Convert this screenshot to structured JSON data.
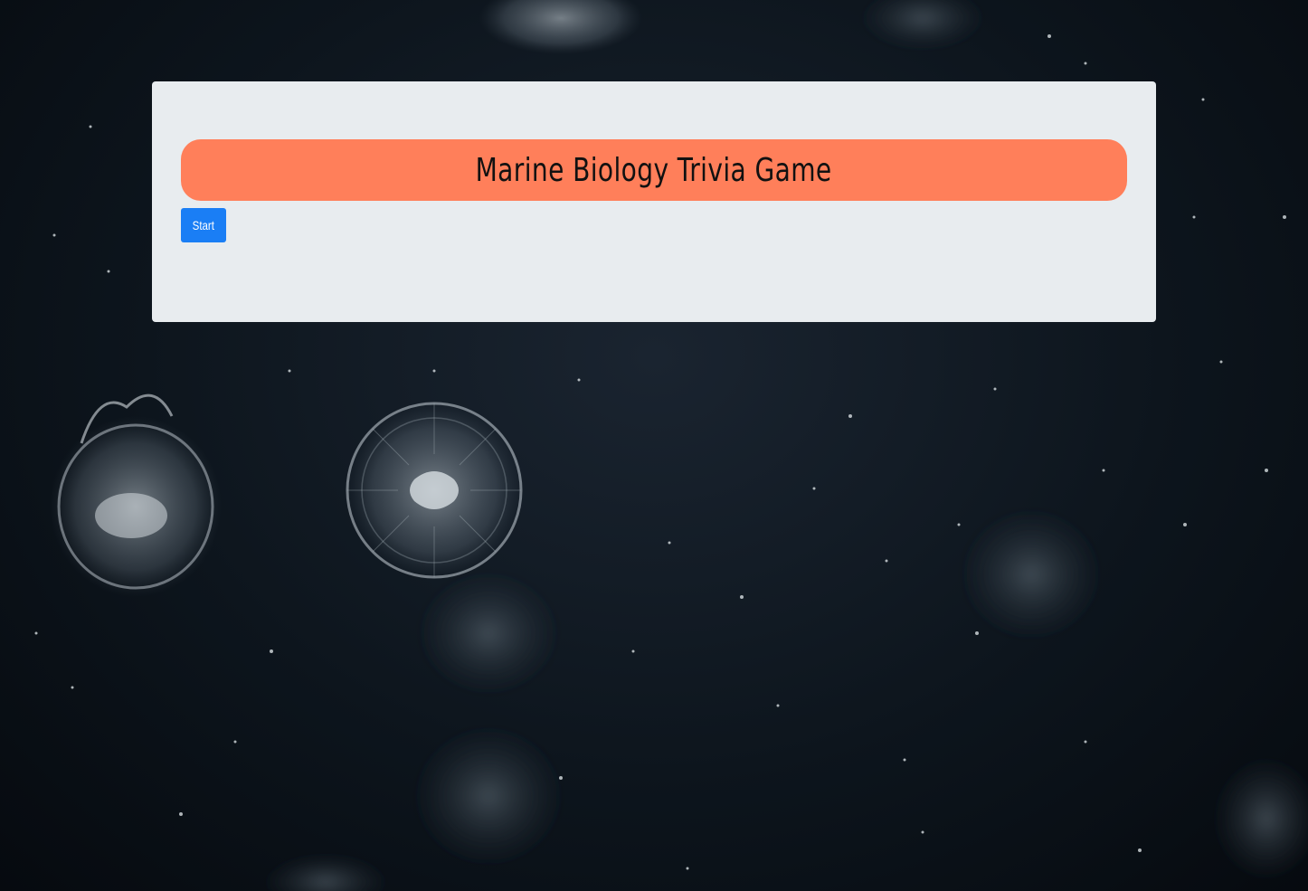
{
  "game": {
    "title": "Marine Biology Trivia Game",
    "start_label": "Start"
  },
  "colors": {
    "page_background": "#0d151d",
    "panel_background": "#e8ecef",
    "title_banner": "#ff7f5a",
    "start_button": "#1a7ef5"
  }
}
